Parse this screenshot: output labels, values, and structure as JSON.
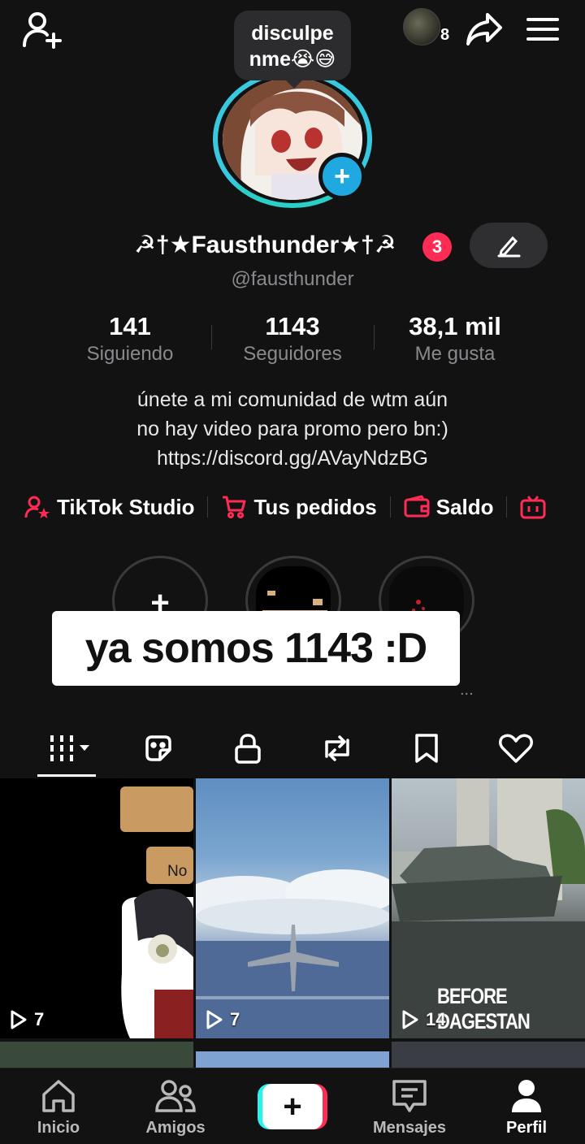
{
  "status_bubble": {
    "line1": "disculpe",
    "line2": "nme😭😅"
  },
  "visitors": {
    "count": "8"
  },
  "profile": {
    "display_name": "☭†★Fausthunder★†☭",
    "notification_count": "3",
    "handle": "@fausthunder"
  },
  "stats": [
    {
      "value": "141",
      "label": "Siguiendo"
    },
    {
      "value": "1143",
      "label": "Seguidores"
    },
    {
      "value": "38,1 mil",
      "label": "Me gusta"
    }
  ],
  "bio": {
    "line1": "únete a mi comunidad de wtm aún",
    "line2": "no hay video para promo pero bn:)",
    "line3": "https://discord.gg/AVayNdzBG"
  },
  "links": [
    {
      "label": "TikTok Studio",
      "icon": "person-star-icon"
    },
    {
      "label": "Tus pedidos",
      "icon": "cart-icon"
    },
    {
      "label": "Saldo",
      "icon": "wallet-icon"
    }
  ],
  "highlights": {
    "add_symbol": "+",
    "more": "..."
  },
  "caption_overlay": "ya somos 1143 :D",
  "videos": [
    {
      "views": "7",
      "overlay_text": "No"
    },
    {
      "views": "7",
      "overlay_text": ""
    },
    {
      "views": "14",
      "overlay_text": "BEFORE DAGESTAN"
    }
  ],
  "bottom_nav": [
    {
      "label": "Inicio",
      "icon": "home-icon"
    },
    {
      "label": "Amigos",
      "icon": "friends-icon"
    },
    {
      "label": "Mensajes",
      "icon": "messages-icon"
    },
    {
      "label": "Perfil",
      "icon": "profile-icon"
    }
  ],
  "colors": {
    "background": "#121212",
    "accent_red": "#fe2c55",
    "accent_cyan": "#25f4ee",
    "ring": "#38c9e0"
  }
}
